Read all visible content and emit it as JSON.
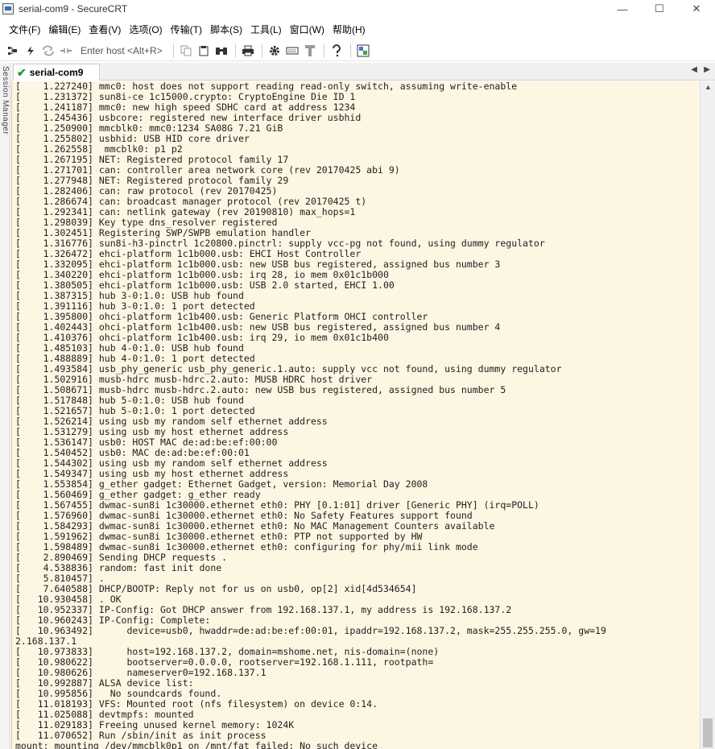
{
  "window": {
    "title": "serial-com9 - SecureCRT",
    "controls": {
      "minimize": "—",
      "maximize": "☐",
      "close": "✕"
    }
  },
  "menu": {
    "items": [
      "文件(F)",
      "编辑(E)",
      "查看(V)",
      "选项(O)",
      "传输(T)",
      "脚本(S)",
      "工具(L)",
      "窗口(W)",
      "帮助(H)"
    ]
  },
  "toolbar": {
    "host_placeholder": "Enter host <Alt+R>"
  },
  "dock": {
    "label": "Session Manager"
  },
  "tabs": [
    {
      "label": "serial-com9",
      "status": "connected"
    }
  ],
  "terminal": {
    "lines": [
      "[    1.227240] mmc0: host does not support reading read-only switch, assuming write-enable",
      "[    1.231372] sun8i-ce 1c15000.crypto: CryptoEngine Die ID 1",
      "[    1.241187] mmc0: new high speed SDHC card at address 1234",
      "[    1.245436] usbcore: registered new interface driver usbhid",
      "[    1.250900] mmcblk0: mmc0:1234 SA08G 7.21 GiB",
      "[    1.255802] usbhid: USB HID core driver",
      "[    1.262558]  mmcblk0: p1 p2",
      "[    1.267195] NET: Registered protocol family 17",
      "[    1.271701] can: controller area network core (rev 20170425 abi 9)",
      "[    1.277948] NET: Registered protocol family 29",
      "[    1.282406] can: raw protocol (rev 20170425)",
      "[    1.286674] can: broadcast manager protocol (rev 20170425 t)",
      "[    1.292341] can: netlink gateway (rev 20190810) max_hops=1",
      "[    1.298039] Key type dns_resolver registered",
      "[    1.302451] Registering SWP/SWPB emulation handler",
      "[    1.316776] sun8i-h3-pinctrl 1c20800.pinctrl: supply vcc-pg not found, using dummy regulator",
      "[    1.326472] ehci-platform 1c1b000.usb: EHCI Host Controller",
      "[    1.332095] ehci-platform 1c1b000.usb: new USB bus registered, assigned bus number 3",
      "[    1.340220] ehci-platform 1c1b000.usb: irq 28, io mem 0x01c1b000",
      "[    1.380505] ehci-platform 1c1b000.usb: USB 2.0 started, EHCI 1.00",
      "[    1.387315] hub 3-0:1.0: USB hub found",
      "[    1.391116] hub 3-0:1.0: 1 port detected",
      "[    1.395800] ohci-platform 1c1b400.usb: Generic Platform OHCI controller",
      "[    1.402443] ohci-platform 1c1b400.usb: new USB bus registered, assigned bus number 4",
      "[    1.410376] ohci-platform 1c1b400.usb: irq 29, io mem 0x01c1b400",
      "[    1.485103] hub 4-0:1.0: USB hub found",
      "[    1.488889] hub 4-0:1.0: 1 port detected",
      "[    1.493584] usb_phy_generic usb_phy_generic.1.auto: supply vcc not found, using dummy regulator",
      "[    1.502916] musb-hdrc musb-hdrc.2.auto: MUSB HDRC host driver",
      "[    1.508671] musb-hdrc musb-hdrc.2.auto: new USB bus registered, assigned bus number 5",
      "[    1.517848] hub 5-0:1.0: USB hub found",
      "[    1.521657] hub 5-0:1.0: 1 port detected",
      "[    1.526214] using usb my random self ethernet address",
      "[    1.531279] using usb my host ethernet address",
      "[    1.536147] usb0: HOST MAC de:ad:be:ef:00:00",
      "[    1.540452] usb0: MAC de:ad:be:ef:00:01",
      "[    1.544302] using usb my random self ethernet address",
      "[    1.549347] using usb my host ethernet address",
      "[    1.553854] g_ether gadget: Ethernet Gadget, version: Memorial Day 2008",
      "[    1.560469] g_ether gadget: g_ether ready",
      "[    1.567455] dwmac-sun8i 1c30000.ethernet eth0: PHY [0.1:01] driver [Generic PHY] (irq=POLL)",
      "[    1.576960] dwmac-sun8i 1c30000.ethernet eth0: No Safety Features support found",
      "[    1.584293] dwmac-sun8i 1c30000.ethernet eth0: No MAC Management Counters available",
      "[    1.591962] dwmac-sun8i 1c30000.ethernet eth0: PTP not supported by HW",
      "[    1.598489] dwmac-sun8i 1c30000.ethernet eth0: configuring for phy/mii link mode",
      "[    2.890469] Sending DHCP requests .",
      "[    4.538836] random: fast init done",
      "[    5.810457] .",
      "[    7.640588] DHCP/BOOTP: Reply not for us on usb0, op[2] xid[4d534654]",
      "[   10.930458] . OK",
      "[   10.952337] IP-Config: Got DHCP answer from 192.168.137.1, my address is 192.168.137.2",
      "[   10.960243] IP-Config: Complete:",
      "[   10.963492]      device=usb0, hwaddr=de:ad:be:ef:00:01, ipaddr=192.168.137.2, mask=255.255.255.0, gw=19",
      "2.168.137.1",
      "[   10.973833]      host=192.168.137.2, domain=mshome.net, nis-domain=(none)",
      "[   10.980622]      bootserver=0.0.0.0, rootserver=192.168.1.111, rootpath=",
      "[   10.980626]      nameserver0=192.168.137.1",
      "[   10.992887] ALSA device list:",
      "[   10.995856]   No soundcards found.",
      "[   11.018193] VFS: Mounted root (nfs filesystem) on device 0:14.",
      "[   11.025088] devtmpfs: mounted",
      "[   11.029183] Freeing unused kernel memory: 1024K",
      "[   11.070652] Run /sbin/init as init process",
      "mount: mounting /dev/mmcblk0p1 on /mnt/fat failed: No such device"
    ]
  }
}
